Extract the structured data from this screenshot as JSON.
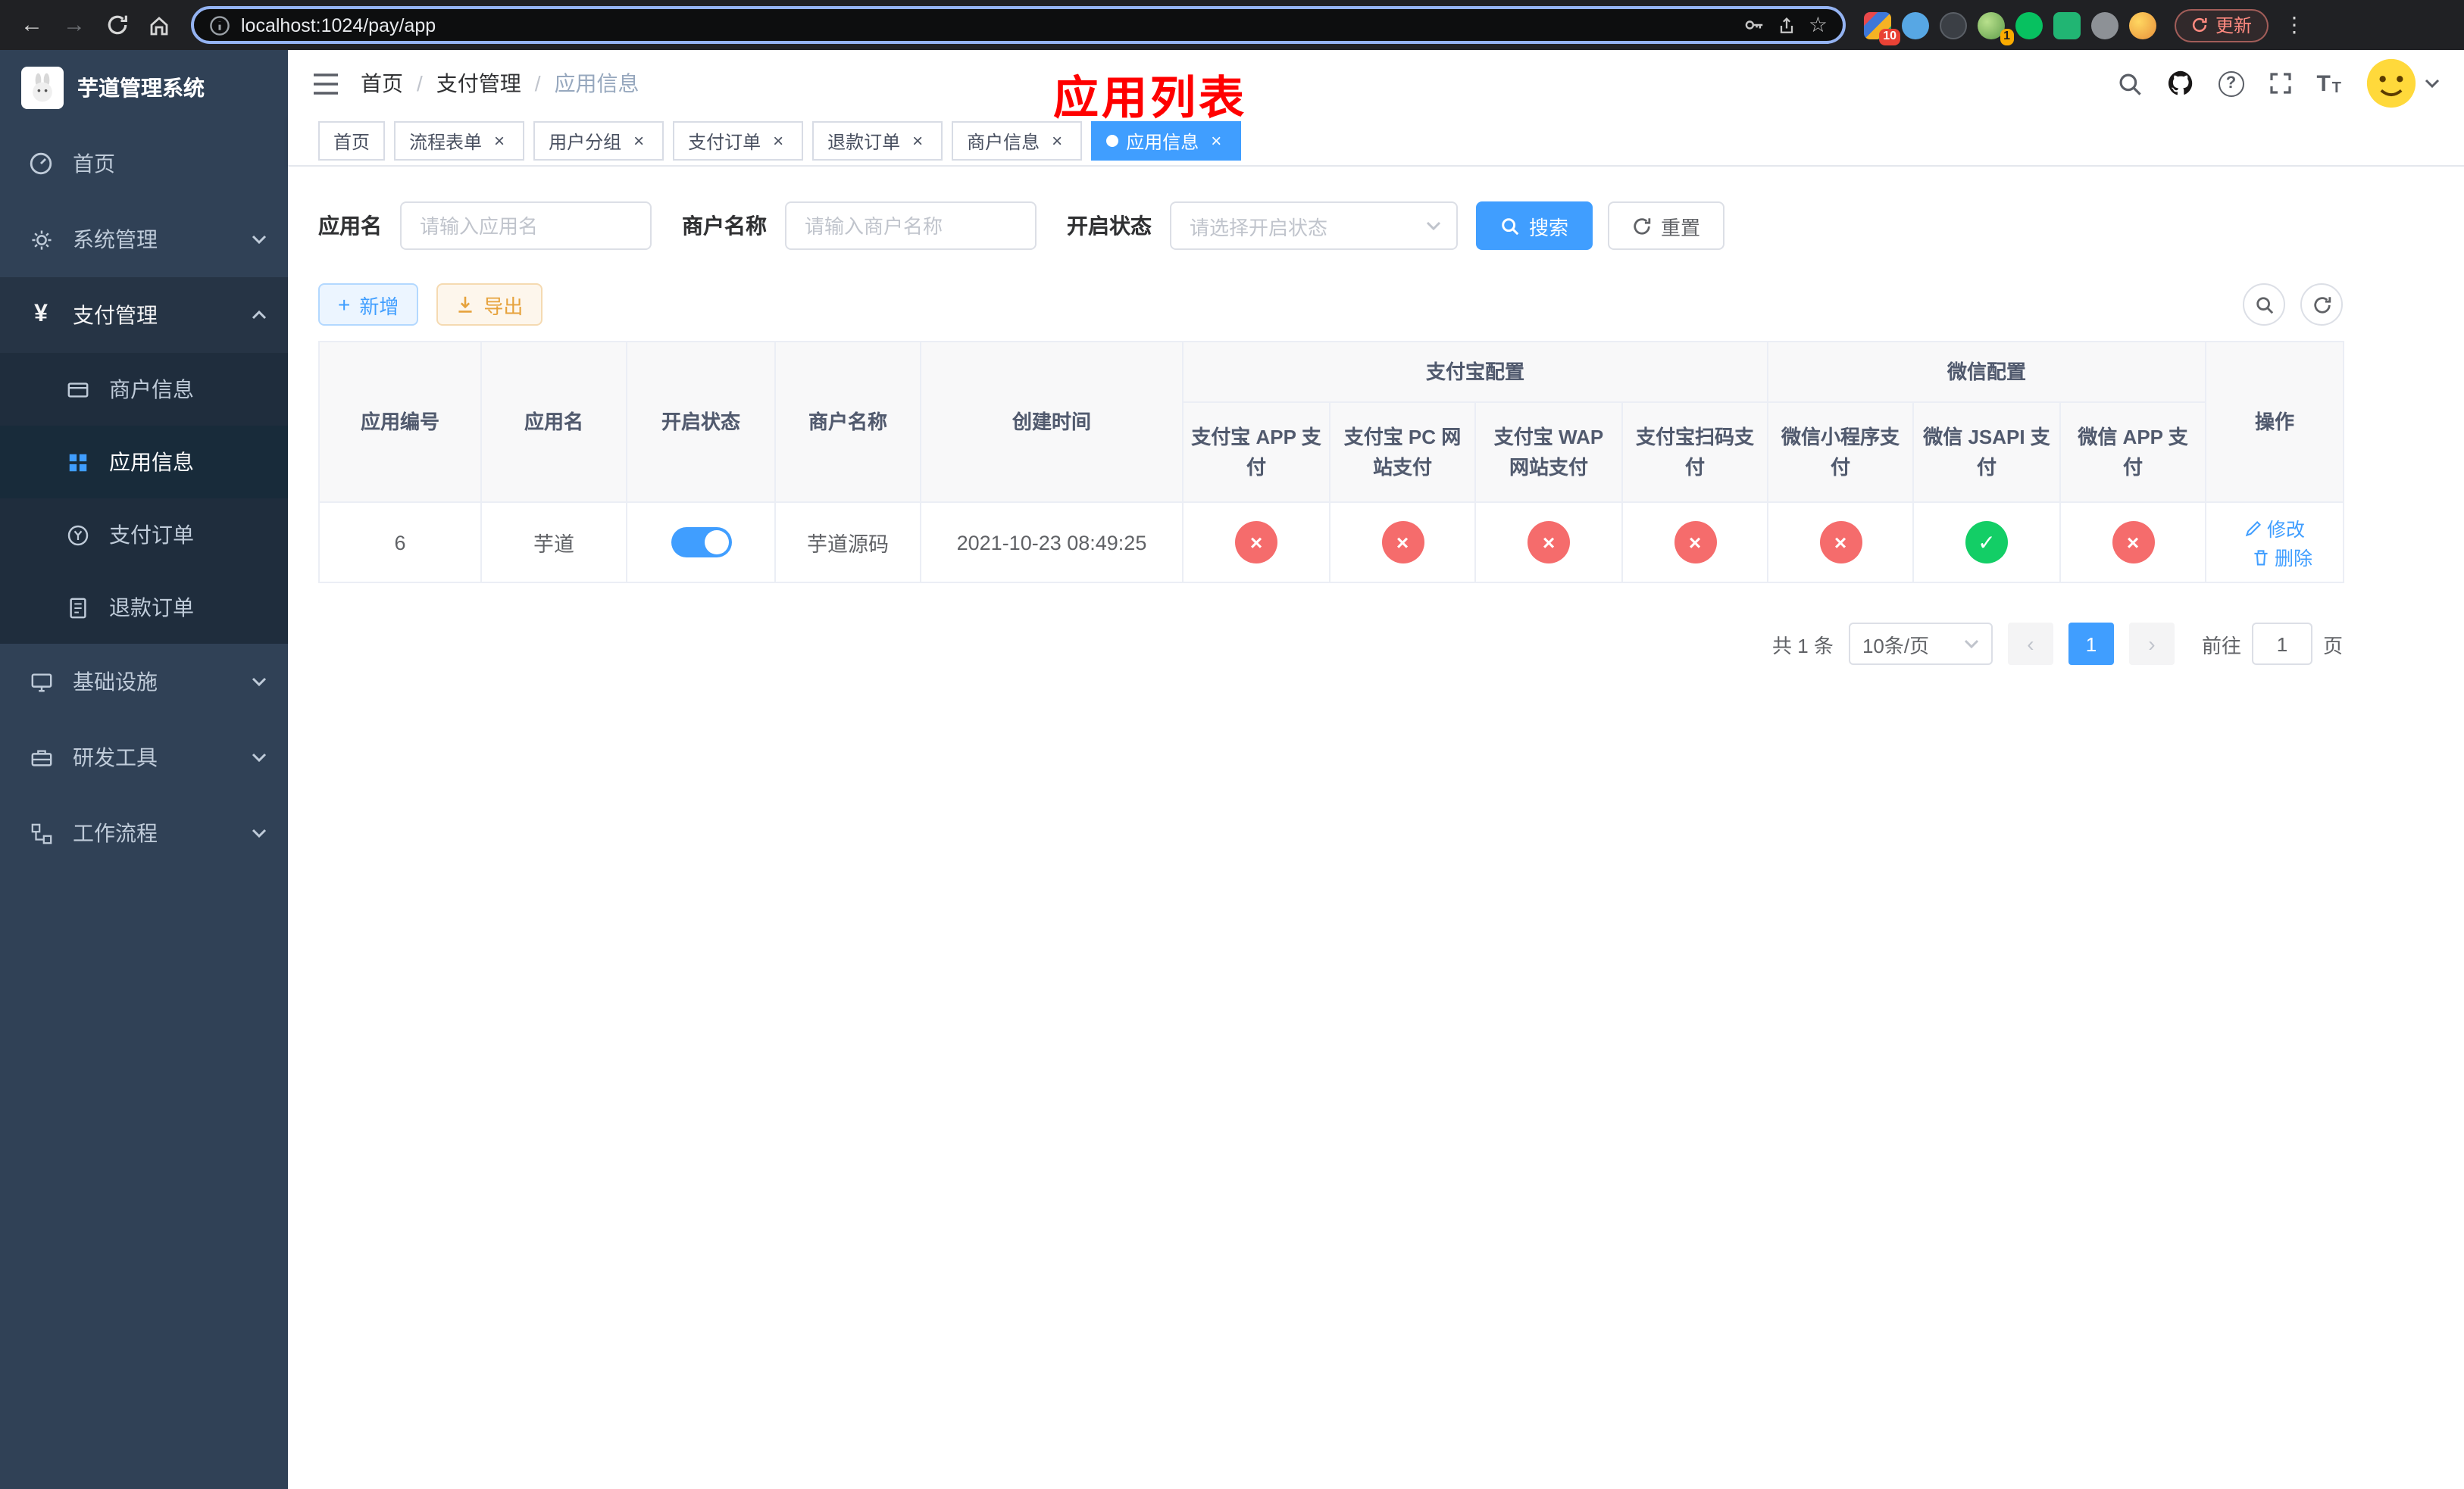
{
  "browser": {
    "url": "localhost:1024/pay/app",
    "update": "更新",
    "ext_badge": "10",
    "profile_badge": "1"
  },
  "sidebar": {
    "title": "芋道管理系统",
    "items": [
      {
        "label": "首页"
      },
      {
        "label": "系统管理"
      },
      {
        "label": "支付管理"
      },
      {
        "label": "基础设施"
      },
      {
        "label": "研发工具"
      },
      {
        "label": "工作流程"
      }
    ],
    "payment_children": [
      {
        "label": "商户信息"
      },
      {
        "label": "应用信息"
      },
      {
        "label": "支付订单"
      },
      {
        "label": "退款订单"
      }
    ]
  },
  "header": {
    "breadcrumb": [
      "首页",
      "支付管理",
      "应用信息"
    ],
    "title": "应用列表"
  },
  "tabs": [
    {
      "label": "首页"
    },
    {
      "label": "流程表单"
    },
    {
      "label": "用户分组"
    },
    {
      "label": "支付订单"
    },
    {
      "label": "退款订单"
    },
    {
      "label": "商户信息"
    },
    {
      "label": "应用信息"
    }
  ],
  "filters": {
    "app_name_label": "应用名",
    "app_name_placeholder": "请输入应用名",
    "merchant_label": "商户名称",
    "merchant_placeholder": "请输入商户名称",
    "status_label": "开启状态",
    "status_placeholder": "请选择开启状态",
    "search": "搜索",
    "reset": "重置"
  },
  "toolbar": {
    "add": "新增",
    "export": "导出"
  },
  "table": {
    "headers": {
      "app_id": "应用编号",
      "app_name": "应用名",
      "status": "开启状态",
      "merchant": "商户名称",
      "created": "创建时间",
      "alipay_group": "支付宝配置",
      "wechat_group": "微信配置",
      "actions": "操作",
      "alipay_cols": [
        "支付宝 APP 支付",
        "支付宝 PC 网站支付",
        "支付宝 WAP 网站支付",
        "支付宝扫码支付"
      ],
      "wechat_cols": [
        "微信小程序支付",
        "微信 JSAPI 支付",
        "微信 APP 支付"
      ]
    },
    "rows": [
      {
        "app_id": "6",
        "app_name": "芋道",
        "toggle": "on",
        "merchant": "芋道源码",
        "created": "2021-10-23 08:49:25",
        "configs": [
          "no",
          "no",
          "no",
          "no",
          "no",
          "ok",
          "no"
        ],
        "edit": "修改",
        "delete": "删除"
      }
    ]
  },
  "pagination": {
    "total": "共 1 条",
    "page_size": "10条/页",
    "page": "1",
    "goto": "前往",
    "goto_value": "1",
    "unit": "页"
  }
}
